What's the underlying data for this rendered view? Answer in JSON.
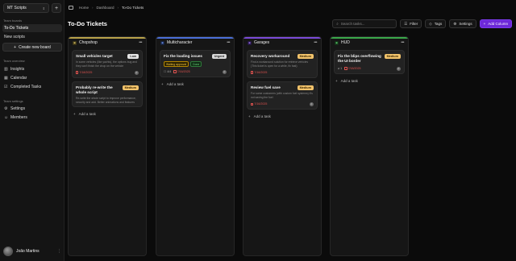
{
  "sidebar": {
    "workspace": "MT Scripts",
    "sections": [
      {
        "label": "Team boards"
      },
      {
        "label": "Team overview"
      },
      {
        "label": "Team settings"
      }
    ],
    "boards": [
      {
        "label": "To-Do Tickets"
      },
      {
        "label": "New scripts"
      }
    ],
    "create_board": "Create new board",
    "overview": [
      {
        "label": "Insights"
      },
      {
        "label": "Calendar"
      },
      {
        "label": "Completed Tasks"
      }
    ],
    "settings": [
      {
        "label": "Settings"
      },
      {
        "label": "Members"
      }
    ],
    "user": "João Martins"
  },
  "breadcrumb": [
    "Home",
    "Dashboard",
    "To-Do Tickets"
  ],
  "page_title": "To-Do Tickets",
  "toolbar": {
    "search_placeholder": "Search tasks...",
    "filter": "Filter",
    "tags": "Tags",
    "settings": "Settings",
    "add": "Add Column"
  },
  "columns": [
    {
      "name": "Chopshop",
      "color": "#b8a24a",
      "cards": [
        {
          "title": "Small vehicles target",
          "priority": "Low",
          "desc": "In some vehicles (like yachts), the options bug and they can't finish the chop on the vehicle",
          "date": "7/18/2025"
        },
        {
          "title": "Probably re-write the whole script",
          "priority": "Medium",
          "desc": "Re-write the whole script to improve performance, security and add. Better animations and features"
        }
      ],
      "add_task": "Add a task"
    },
    {
      "name": "Multicharacter",
      "color": "#4a6fd8",
      "cards": [
        {
          "title": "Fix the loading issues",
          "priority": "Urgent",
          "tag1": "Waiting approval",
          "tag2": "Done",
          "count": "4/4",
          "date": "7/16/2025"
        }
      ],
      "add_task": "Add a task"
    },
    {
      "name": "Garages",
      "color": "#7a4ad8",
      "cards": [
        {
          "title": "Recovery workaround",
          "priority": "Medium",
          "desc": "Find a workaround solution for retrieve vehicles (This ticket is open for a while, fix fast)",
          "date": "7/16/2025"
        },
        {
          "title": "Review fuel save",
          "priority": "Medium",
          "desc": "For some customers (with custom fuel systems) it's not saving the fuel",
          "date": "7/16/2025"
        }
      ],
      "add_task": "Add a task"
    },
    {
      "name": "HUD",
      "color": "#3aa84a",
      "cards": [
        {
          "title": "Fix the blips overflowing the UI border",
          "priority": "Medium",
          "count": "1",
          "date": "7/18/2025"
        }
      ],
      "add_task": "Add a task"
    }
  ],
  "colors": {
    "accent": "#6d28d9",
    "overdue": "#e0524f",
    "medium": "#f2c36b"
  },
  "icons": [
    "sidebar-toggle-icon",
    "search-icon",
    "filter-icon",
    "tag-icon",
    "gear-icon",
    "plus-icon",
    "calendar-icon",
    "kebab-icon"
  ]
}
